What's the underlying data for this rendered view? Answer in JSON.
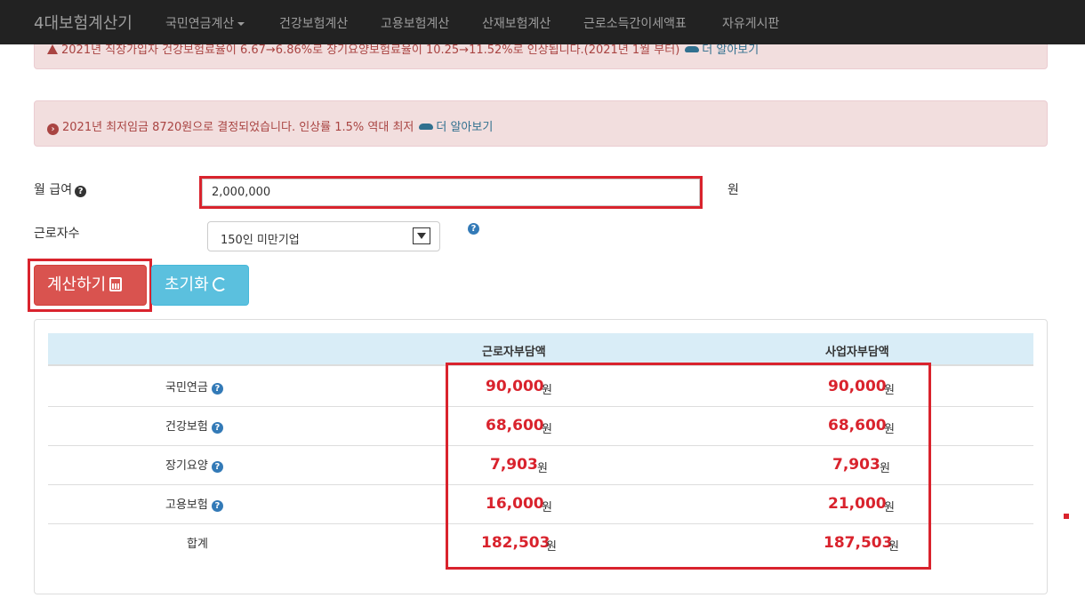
{
  "nav": {
    "brand": "4대보험계산기",
    "items": [
      "국민연금계산",
      "건강보험계산",
      "고용보험계산",
      "산재보험계산",
      "근로소득간이세액표",
      "자유게시판"
    ]
  },
  "alerts": {
    "top": {
      "text": "2021년 직장가입자 건강보험료율이 6.67→6.86%로 장기요양보험료율이 10.25→11.52%로 인상됩니다.(2021년 1월 부터)",
      "link": "더 알아보기"
    },
    "mid": {
      "text": "2021년 최저임금 8720원으로 결정되었습니다. 인상률 1.5% 역대 최저",
      "link": "더 알아보기"
    }
  },
  "form": {
    "salary_label": "월 급여",
    "salary_value": "2,000,000",
    "salary_unit": "원",
    "workers_label": "근로자수",
    "workers_selected": "150인 미만기업"
  },
  "buttons": {
    "calculate": "계산하기",
    "reset": "초기화"
  },
  "table": {
    "headers": [
      "근로자부담액",
      "사업자부담액"
    ],
    "unit": "원",
    "rows": [
      {
        "label": "국민연금",
        "employee": "90,000",
        "employer": "90,000"
      },
      {
        "label": "건강보험",
        "employee": "68,600",
        "employer": "68,600"
      },
      {
        "label": "장기요양",
        "employee": "7,903",
        "employer": "7,903"
      },
      {
        "label": "고용보험",
        "employee": "16,000",
        "employer": "21,000"
      },
      {
        "label": "합계",
        "employee": "182,503",
        "employer": "187,503"
      }
    ]
  },
  "colors": {
    "navbar": "#222222",
    "alert_bg": "#f2dede",
    "highlight": "#d9232d",
    "calc_button": "#d9534f",
    "reset_button": "#5bc0de",
    "table_header": "#d9edf7"
  }
}
